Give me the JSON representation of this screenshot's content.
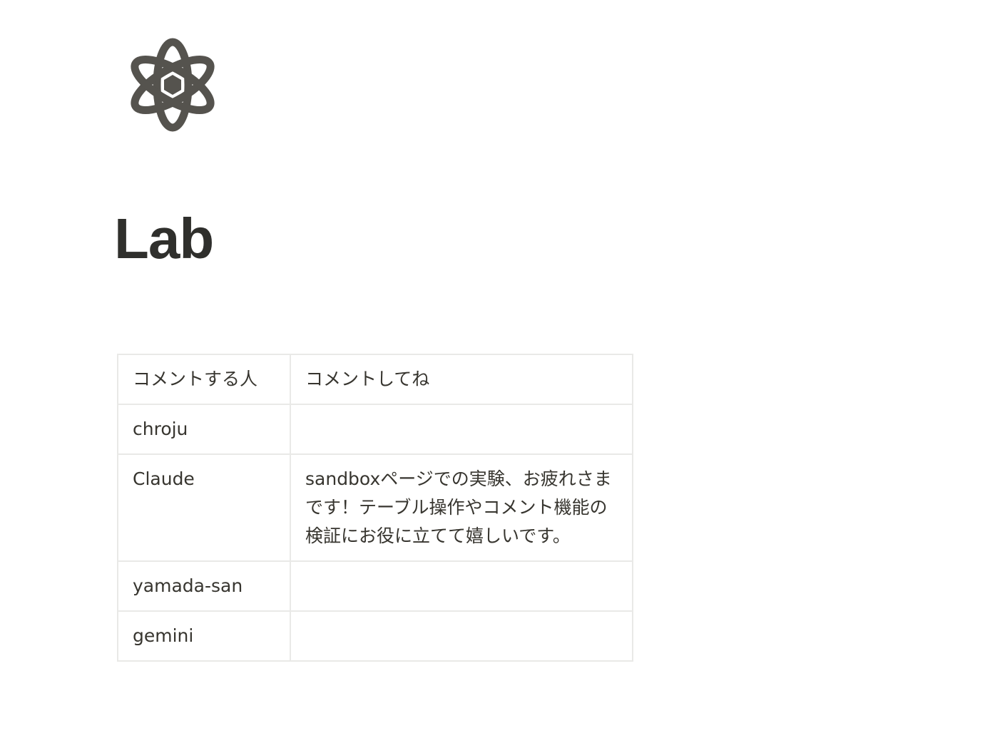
{
  "page": {
    "icon": "atom-icon",
    "title": "Lab"
  },
  "table": {
    "header": {
      "person": "コメントする人",
      "comment": "コメントしてね"
    },
    "rows": [
      {
        "person": "chroju",
        "comment": ""
      },
      {
        "person": "Claude",
        "comment": "sandboxページでの実験、お疲れさまです！テーブル操作やコメント機能の検証にお役に立てて嬉しいです。"
      },
      {
        "person": "yamada-san",
        "comment": ""
      },
      {
        "person": "gemini",
        "comment": ""
      }
    ]
  },
  "colors": {
    "text": "#37352f",
    "border": "#e9e9e7",
    "icon": "#55534e"
  }
}
